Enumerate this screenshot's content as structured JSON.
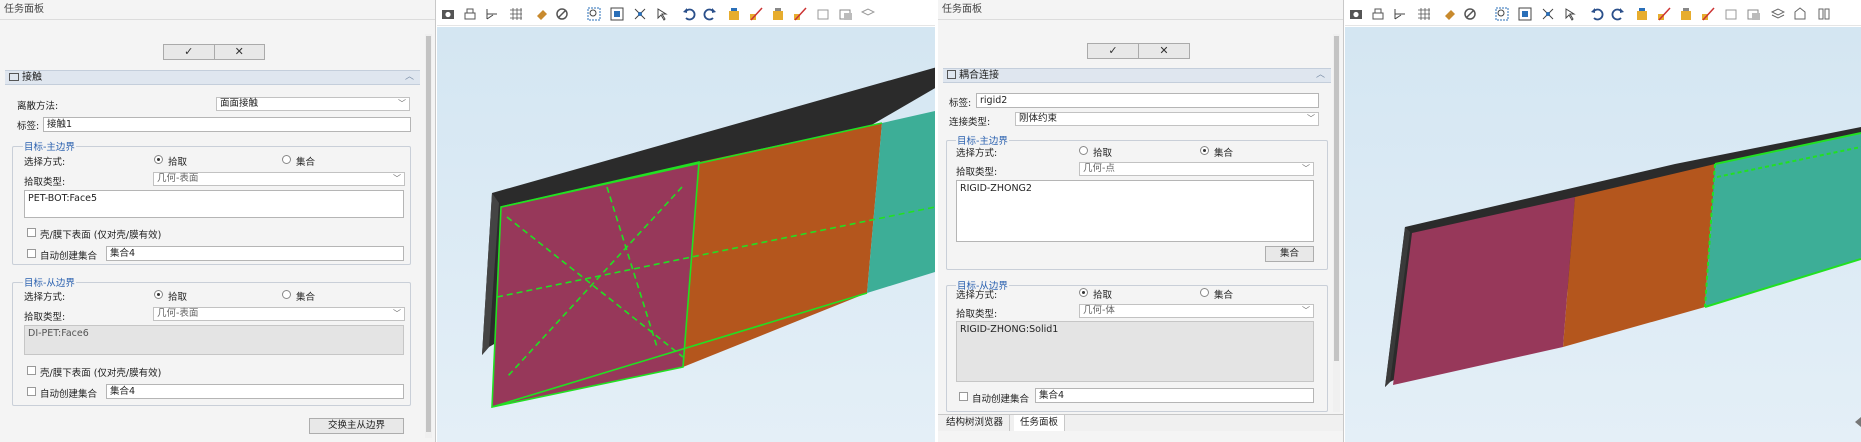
{
  "left": {
    "panel_title": "任务面板",
    "ok_icon": "check-icon",
    "cancel_icon": "close-icon",
    "section_title": "接触",
    "discrete_method_label": "离散方法:",
    "discrete_method_value": "面面接触",
    "tag_label": "标签:",
    "tag_value": "接触1",
    "master": {
      "legend": "目标-主边界",
      "select_mode_label": "选择方式:",
      "option_pick": "拾取",
      "option_set": "集合",
      "selected": "拾取",
      "pick_type_label": "拾取类型:",
      "pick_type_value": "几何-表面",
      "selection_text": "PET-BOT:Face5",
      "shell_lower_label": "壳/膜下表面 (仅对壳/膜有效)",
      "auto_set_label": "自动创建集合",
      "auto_set_value": "集合4"
    },
    "slave": {
      "legend": "目标-从边界",
      "select_mode_label": "选择方式:",
      "option_pick": "拾取",
      "option_set": "集合",
      "selected": "拾取",
      "pick_type_label": "拾取类型:",
      "pick_type_value": "几何-表面",
      "selection_text": "DI-PET:Face6",
      "shell_lower_label": "壳/膜下表面 (仅对壳/膜有效)",
      "auto_set_label": "自动创建集合",
      "auto_set_value": "集合4"
    },
    "swap_button": "交换主从边界"
  },
  "right": {
    "panel_title": "任务面板",
    "ok_icon": "check-icon",
    "cancel_icon": "close-icon",
    "section_title": "耦合连接",
    "tag_label": "标签:",
    "tag_value": "rigid2",
    "conn_type_label": "连接类型:",
    "conn_type_value": "刚体约束",
    "master": {
      "legend": "目标-主边界",
      "select_mode_label": "选择方式:",
      "option_pick": "拾取",
      "option_set": "集合",
      "selected": "集合",
      "pick_type_label": "拾取类型:",
      "pick_type_value": "几何-点",
      "selection_text": "RIGID-ZHONG2",
      "set_button": "集合"
    },
    "slave": {
      "legend": "目标-从边界",
      "select_mode_label": "选择方式:",
      "option_pick": "拾取",
      "option_set": "集合",
      "selected": "拾取",
      "pick_type_label": "拾取类型:",
      "pick_type_value": "几何-体",
      "selection_text": "RIGID-ZHONG:Solid1",
      "auto_set_label": "自动创建集合",
      "auto_set_value": "集合4"
    },
    "tabs": [
      "结构树浏览器",
      "任务面板"
    ],
    "active_tab": "任务面板"
  },
  "toolbar_icons": [
    "camera-icon",
    "print-icon",
    "axis-icon",
    "grid-icon",
    "paint-icon",
    "no-display-icon",
    "zoom-box-icon",
    "fit-icon",
    "rotate-icon",
    "pick-icon",
    "undo-icon",
    "redo-icon",
    "highlight-icon",
    "display-icon",
    "part-icon",
    "part-display-icon",
    "hide-icon",
    "show-icon",
    "layer-icon"
  ],
  "colors": {
    "section_bg": "#dfe6ef",
    "legend_blue": "#2c62b0",
    "face_pink": "#97385a",
    "face_orange": "#b4561d",
    "face_teal": "#3dae97",
    "select_green": "#22e022"
  }
}
